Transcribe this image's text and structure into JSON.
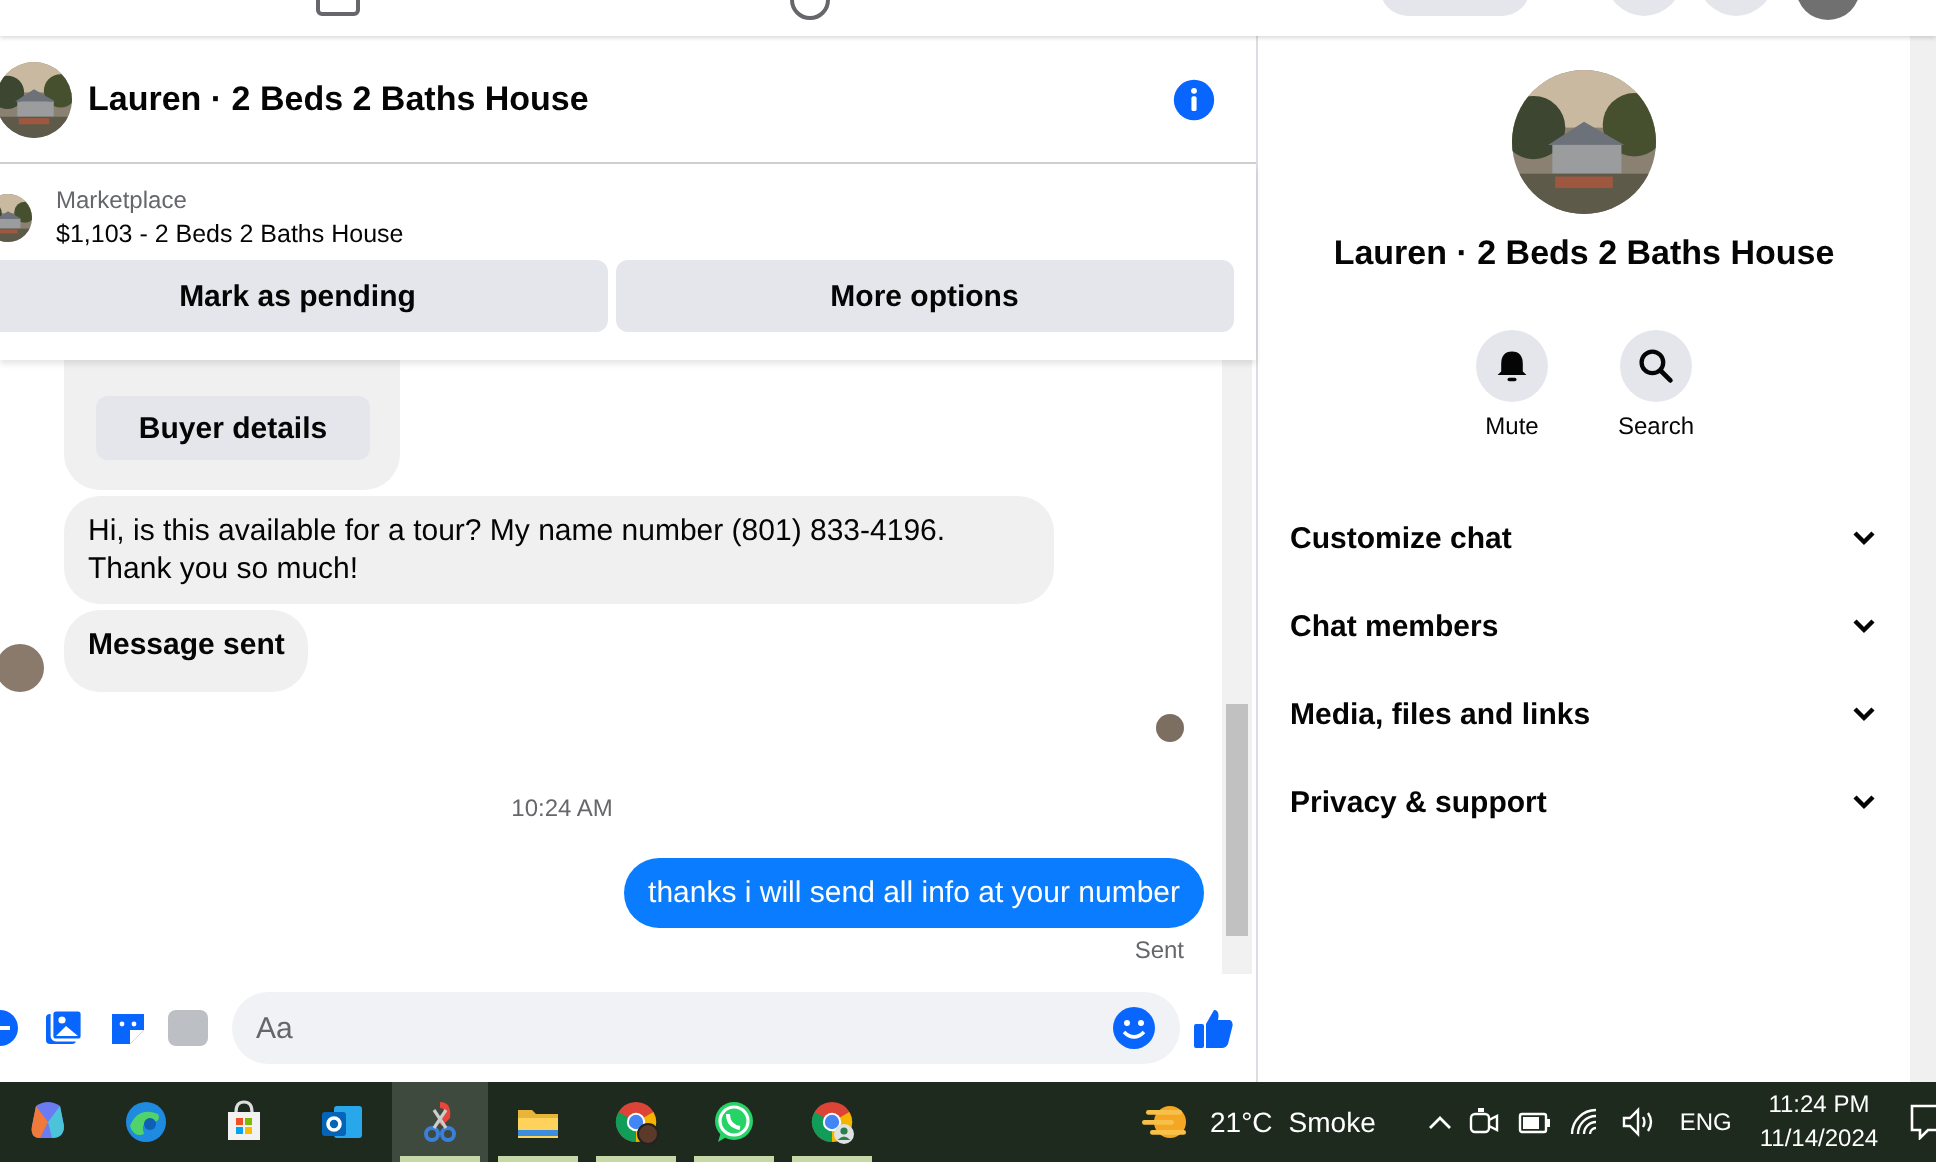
{
  "conversation": {
    "title": "Lauren · 2 Beds 2 Baths House"
  },
  "listing": {
    "source": "Marketplace",
    "summary": "$1,103 - 2 Beds 2 Baths House",
    "actions": [
      "Mark as pending",
      "More options"
    ]
  },
  "messages": [
    {
      "kind": "card",
      "button": "Buyer details"
    },
    {
      "kind": "incoming",
      "text": "Hi, is this available for a tour? My name number (801) 833-4196.\nThank you so much!",
      "bold": false,
      "avatar": false
    },
    {
      "kind": "incoming",
      "text": "Message sent",
      "bold": true,
      "avatar": true
    },
    {
      "kind": "seen"
    },
    {
      "kind": "timestamp",
      "text": "10:24 AM"
    },
    {
      "kind": "outgoing",
      "text": "thanks i will send all info at your number",
      "status": "Sent"
    }
  ],
  "composer": {
    "placeholder": "Aa"
  },
  "details": {
    "title": "Lauren · 2 Beds 2 Baths House",
    "actions": [
      {
        "kind": "mute",
        "label": "Mute"
      },
      {
        "kind": "search",
        "label": "Search"
      }
    ],
    "sections": [
      {
        "label": "Customize chat",
        "expanded": false
      },
      {
        "label": "Chat members",
        "expanded": false
      },
      {
        "label": "Media, files and links",
        "expanded": false
      },
      {
        "label": "Privacy & support",
        "expanded": false
      }
    ]
  },
  "taskbar": {
    "apps": [
      {
        "kind": "copilot",
        "running": false,
        "selected": false
      },
      {
        "kind": "edge",
        "running": false,
        "selected": false
      },
      {
        "kind": "store",
        "running": false,
        "selected": false
      },
      {
        "kind": "outlook",
        "running": false,
        "selected": false
      },
      {
        "kind": "snipping",
        "running": true,
        "selected": true
      },
      {
        "kind": "explorer",
        "running": true,
        "selected": false
      },
      {
        "kind": "chrome",
        "running": true,
        "selected": false
      },
      {
        "kind": "whatsapp",
        "running": true,
        "selected": false
      },
      {
        "kind": "chrome-profile",
        "running": true,
        "selected": false
      }
    ],
    "weather": {
      "temperature": "21°C",
      "condition": "Smoke"
    },
    "language": "ENG",
    "time": "11:24 PM",
    "date": "11/14/2024"
  }
}
